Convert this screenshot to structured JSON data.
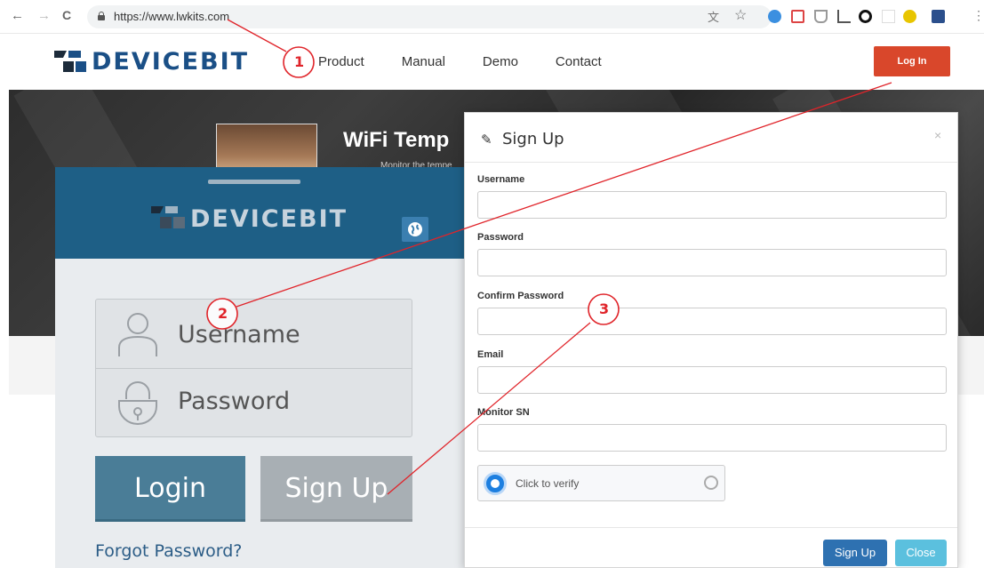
{
  "browser": {
    "url": "https://www.lwkits.com",
    "back": "←",
    "forward": "→",
    "reload": "C",
    "star": "☆"
  },
  "site": {
    "logo_text": "DEVICEBIT",
    "nav": [
      "Product",
      "Manual",
      "Demo",
      "Contact"
    ],
    "login_button": "Log In",
    "colors": {
      "login_button": "#d9472b",
      "logo_blue": "#1a4f86",
      "logo_dark": "#1c2b3a"
    }
  },
  "hero": {
    "title": "WiFi Temp",
    "subtitle": "Monitor the tempe"
  },
  "app_panel": {
    "logo_text": "DEVICEBIT",
    "username_placeholder": "Username",
    "password_placeholder": "Password",
    "login_button": "Login",
    "signup_button": "Sign Up",
    "forgot_link": "Forgot Password?",
    "colors": {
      "header": "#1e5f86",
      "login": "#4a7d97",
      "signup": "#a8afb4"
    }
  },
  "modal": {
    "title": "Sign Up",
    "close_glyph": "×",
    "fields": [
      {
        "label": "Username",
        "value": ""
      },
      {
        "label": "Password",
        "value": ""
      },
      {
        "label": "Confirm Password",
        "value": ""
      },
      {
        "label": "Email",
        "value": ""
      },
      {
        "label": "Monitor SN",
        "value": ""
      }
    ],
    "verify_text": "Click to verify",
    "signup_button": "Sign Up",
    "close_button": "Close",
    "colors": {
      "signup": "#2e71b1",
      "close": "#5bc0de"
    }
  },
  "annotations": [
    "1",
    "2",
    "3"
  ]
}
